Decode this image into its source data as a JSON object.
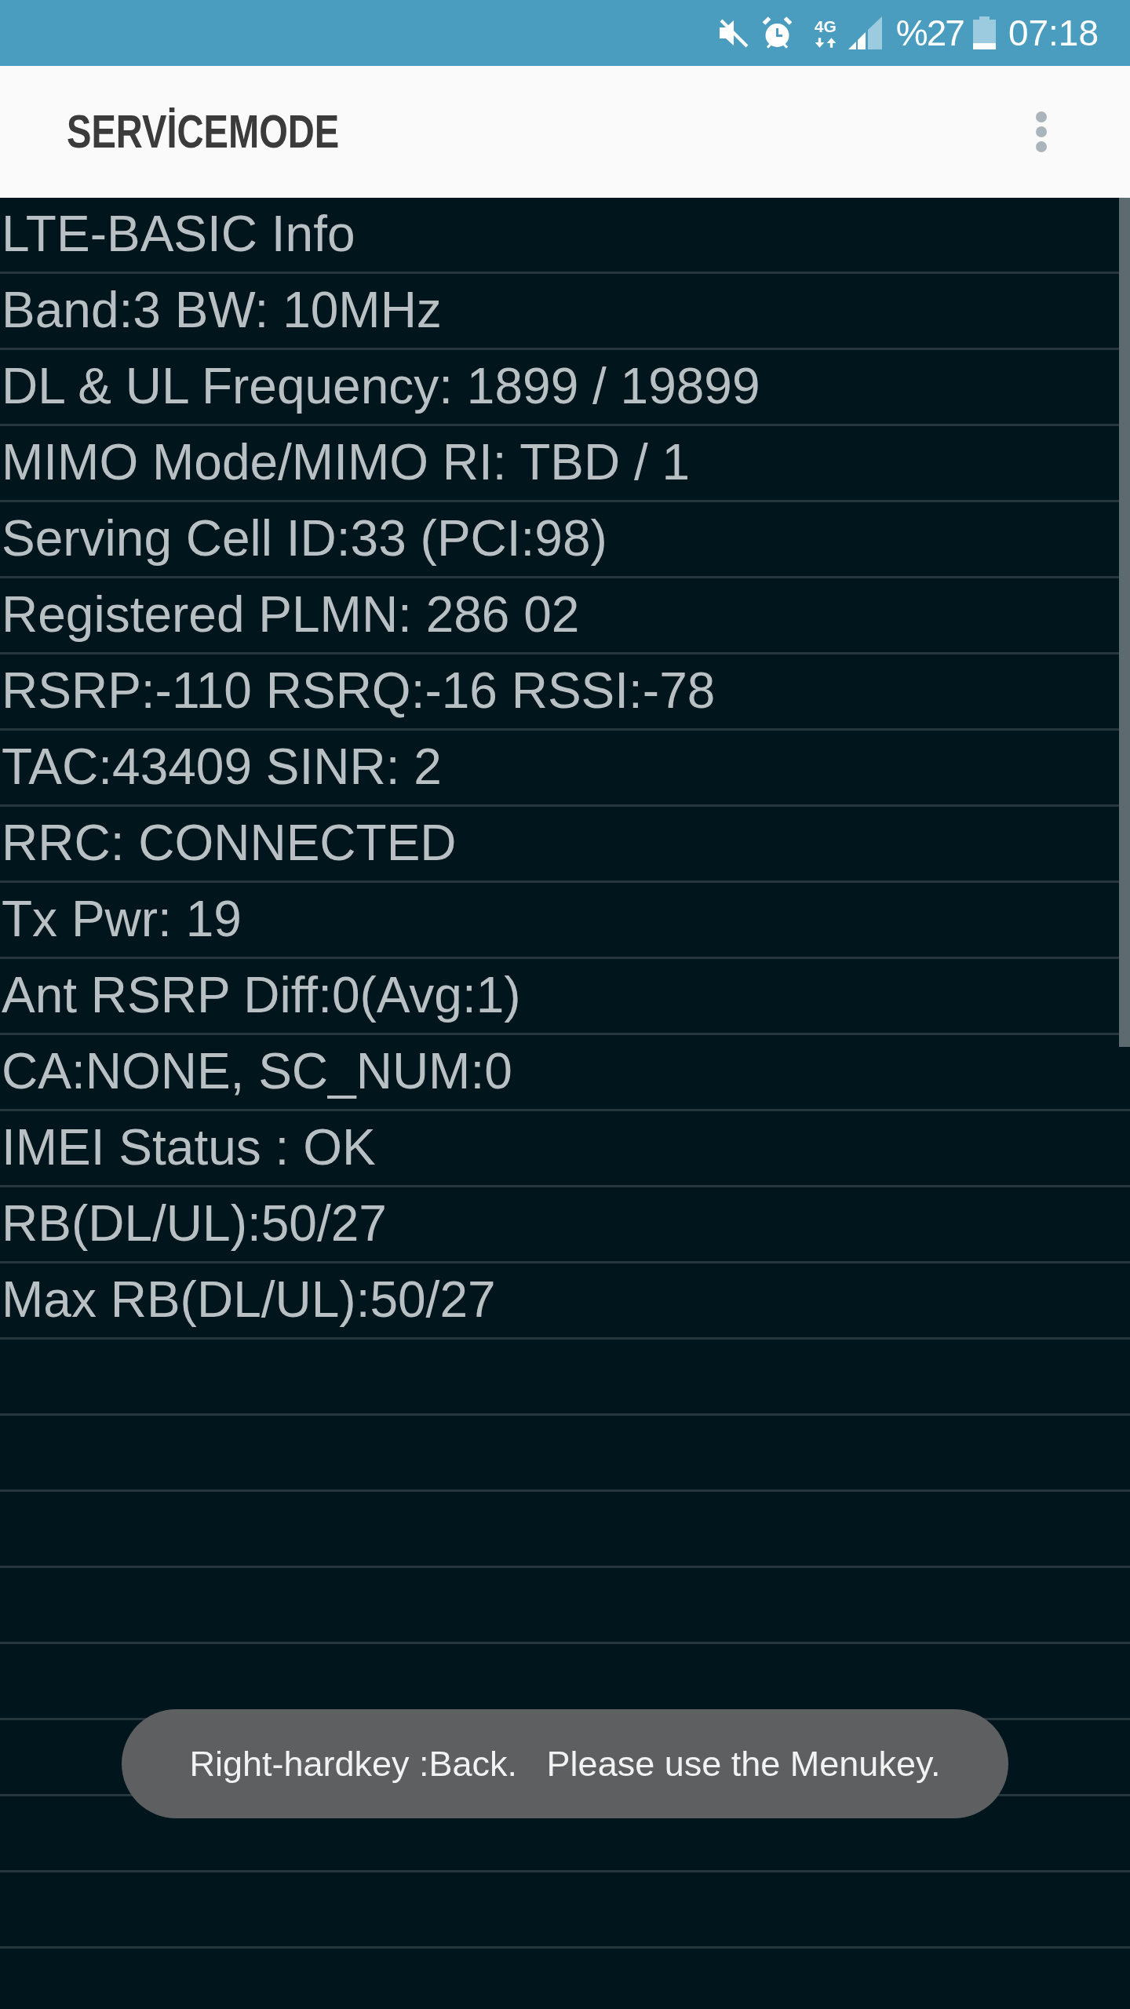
{
  "status_bar": {
    "network_type": "4G",
    "battery": "%27",
    "time": "07:18"
  },
  "app_bar": {
    "title": "SERVİCEMODE"
  },
  "info_lines": [
    "LTE-BASIC Info",
    "Band:3 BW: 10MHz",
    "DL & UL Frequency: 1899 / 19899",
    "MIMO Mode/MIMO RI: TBD / 1",
    "Serving Cell ID:33 (PCI:98)",
    "Registered PLMN: 286 02",
    "RSRP:-110 RSRQ:-16 RSSI:-78",
    "TAC:43409 SINR: 2",
    "RRC: CONNECTED",
    "Tx Pwr: 19",
    "Ant RSRP Diff:0(Avg:1)",
    "CA:NONE, SC_NUM:0",
    "IMEI Status : OK",
    "RB(DL/UL):50/27",
    "Max RB(DL/UL):50/27"
  ],
  "toast": {
    "message": "Right-hardkey :Back.   Please use the Menukey."
  }
}
